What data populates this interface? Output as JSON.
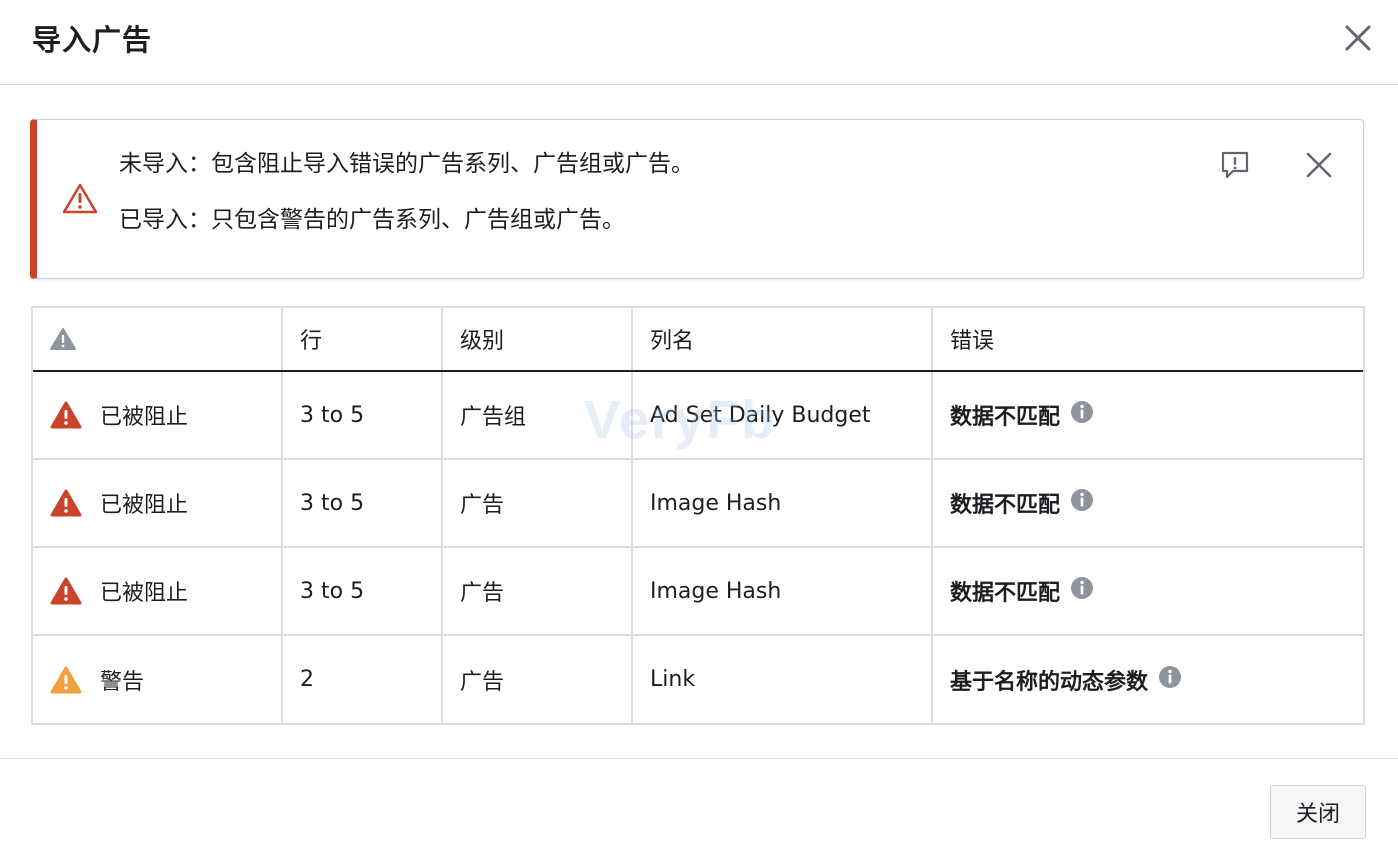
{
  "dialog": {
    "title": "导入广告",
    "close_label": "关闭"
  },
  "alert": {
    "line1": "未导入：包含阻止导入错误的广告系列、广告组或广告。",
    "line2": "已导入：只包含警告的广告系列、广告组或广告。",
    "accent_color": "#c8442a"
  },
  "watermark": "VeryFb",
  "table": {
    "headers": [
      "",
      "行",
      "级别",
      "列名",
      "错误"
    ],
    "rows": [
      {
        "status": "已被阻止",
        "status_icon": "blocked-icon",
        "row": "3 to 5",
        "level": "广告组",
        "column": "Ad Set Daily Budget",
        "error": "数据不匹配"
      },
      {
        "status": "已被阻止",
        "status_icon": "blocked-icon",
        "row": "3 to 5",
        "level": "广告",
        "column": "Image Hash",
        "error": "数据不匹配"
      },
      {
        "status": "已被阻止",
        "status_icon": "blocked-icon",
        "row": "3 to 5",
        "level": "广告",
        "column": "Image Hash",
        "error": "数据不匹配"
      },
      {
        "status": "警告",
        "status_icon": "warning-icon",
        "row": "2",
        "level": "广告",
        "column": "Link",
        "error": "基于名称的动态参数"
      }
    ]
  },
  "colors": {
    "blocked": "#c8442a",
    "warning": "#f0a03c",
    "info": "#8d949e"
  }
}
